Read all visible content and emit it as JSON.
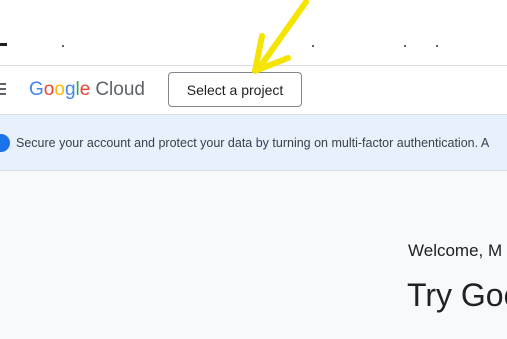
{
  "header": {
    "logo_google": "Google",
    "logo_cloud": "Cloud",
    "project_button": "Select a project"
  },
  "banner": {
    "message": "Secure your account and protect your data by turning on multi-factor authentication. A"
  },
  "main": {
    "welcome": "Welcome, M",
    "headline": "Try Goo"
  },
  "colors": {
    "google_blue": "#4285F4",
    "google_red": "#EA4335",
    "google_yellow": "#FBBC05",
    "google_green": "#34A853",
    "banner_bg": "#e8f0fe",
    "annotation_arrow": "#f5e400"
  },
  "icons": {
    "menu": "hamburger-menu-icon",
    "banner": "info-icon",
    "annotation": "arrow-annotation"
  }
}
